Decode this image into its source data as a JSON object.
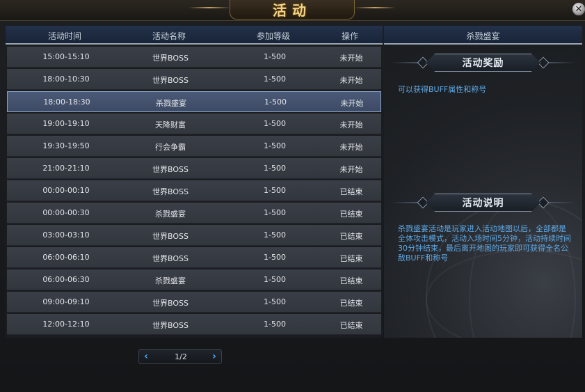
{
  "window": {
    "title": "活动",
    "close_label": "✕"
  },
  "table": {
    "headers": {
      "time": "活动时间",
      "name": "活动名称",
      "level": "参加等级",
      "operation": "操作"
    },
    "rows": [
      {
        "time": "15:00-15:10",
        "name": "世界BOSS",
        "level": "1-500",
        "status": "未开始"
      },
      {
        "time": "18:00-10:30",
        "name": "世界BOSS",
        "level": "1-500",
        "status": "未开始"
      },
      {
        "time": "18:00-18:30",
        "name": "杀戮盛宴",
        "level": "1-500",
        "status": "未开始"
      },
      {
        "time": "19:00-19:10",
        "name": "天降财富",
        "level": "1-500",
        "status": "未开始"
      },
      {
        "time": "19:30-19:50",
        "name": "行会争霸",
        "level": "1-500",
        "status": "未开始"
      },
      {
        "time": "21:00-21:10",
        "name": "世界BOSS",
        "level": "1-500",
        "status": "未开始"
      },
      {
        "time": "00:00-00:10",
        "name": "世界BOSS",
        "level": "1-500",
        "status": "已结束"
      },
      {
        "time": "00:00-00:30",
        "name": "杀戮盛宴",
        "level": "1-500",
        "status": "已结束"
      },
      {
        "time": "03:00-03:10",
        "name": "世界BOSS",
        "level": "1-500",
        "status": "已结束"
      },
      {
        "time": "06:00-06:10",
        "name": "世界BOSS",
        "level": "1-500",
        "status": "已结束"
      },
      {
        "time": "06:00-06:30",
        "name": "杀戮盛宴",
        "level": "1-500",
        "status": "已结束"
      },
      {
        "time": "09:00-09:10",
        "name": "世界BOSS",
        "level": "1-500",
        "status": "已结束"
      },
      {
        "time": "12:00-12:10",
        "name": "世界BOSS",
        "level": "1-500",
        "status": "已结束"
      }
    ],
    "selected_index": 2
  },
  "pager": {
    "prev_icon": "‹",
    "next_icon": "›",
    "text": "1/2"
  },
  "detail": {
    "title": "杀戮盛宴",
    "reward_heading": "活动奖励",
    "reward_text": "可以获得BUFF属性和称号",
    "desc_heading": "活动说明",
    "desc_text": "杀戮盛宴活动是玩家进入活动地图以后，全部都是全体攻击模式，活动入场时间5分钟，活动持续时间30分钟结束，最后离开地图的玩家即可获得全名公敌BUFF和称号"
  },
  "colors": {
    "accent_title": "#f4d58a",
    "info_text": "#5fa9e6",
    "selected_row": "#4b5a78"
  }
}
